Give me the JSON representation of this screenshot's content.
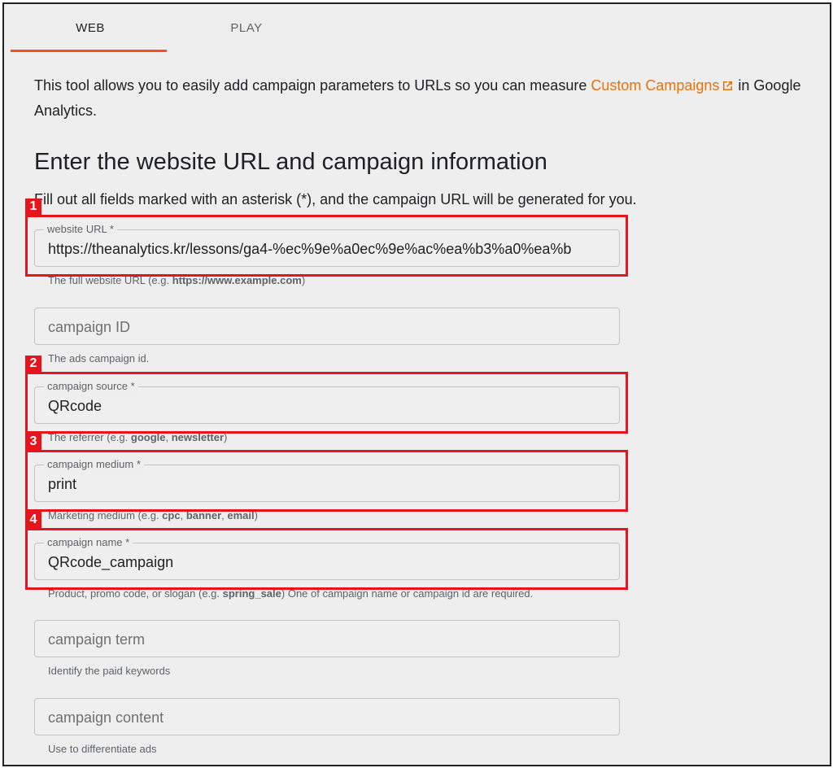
{
  "tabs": {
    "web": "WEB",
    "play": "PLAY"
  },
  "intro": {
    "text_before": "This tool allows you to easily add campaign parameters to URLs so you can measure ",
    "link": "Custom Campaigns",
    "text_after": " in Google Analytics."
  },
  "heading": "Enter the website URL and campaign information",
  "subtext": "Fill out all fields marked with an asterisk (*), and the campaign URL will be generated for you.",
  "fields": {
    "website_url": {
      "label": "website URL *",
      "value": "https://theanalytics.kr/lessons/ga4-%ec%9e%a0ec%9e%ac%ea%b3%a0%ea%b",
      "helper_prefix": "The full website URL (e.g. ",
      "helper_bold": "https://www.example.com",
      "helper_suffix": ")"
    },
    "campaign_id": {
      "placeholder": "campaign ID",
      "helper": "The ads campaign id."
    },
    "campaign_source": {
      "label": "campaign source *",
      "value": "QRcode",
      "helper_prefix": "The referrer (e.g. ",
      "helper_bold1": "google",
      "helper_sep": ", ",
      "helper_bold2": "newsletter",
      "helper_suffix": ")"
    },
    "campaign_medium": {
      "label": "campaign medium *",
      "value": "print",
      "helper_prefix": "Marketing medium (e.g. ",
      "helper_bold1": "cpc",
      "helper_sep1": ", ",
      "helper_bold2": "banner",
      "helper_sep2": ", ",
      "helper_bold3": "email",
      "helper_suffix": ")"
    },
    "campaign_name": {
      "label": "campaign name *",
      "value": "QRcode_campaign",
      "helper_prefix": "Product, promo code, or slogan (e.g. ",
      "helper_bold": "spring_sale",
      "helper_suffix": ") One of campaign name or campaign id are required."
    },
    "campaign_term": {
      "placeholder": "campaign term",
      "helper": "Identify the paid keywords"
    },
    "campaign_content": {
      "placeholder": "campaign content",
      "helper": "Use to differentiate ads"
    }
  },
  "annotations": [
    "1",
    "2",
    "3",
    "4"
  ],
  "colors": {
    "accent": "#f4511e",
    "link": "#e8710a",
    "annotation": "#e8141c",
    "background": "#eeeeee"
  }
}
